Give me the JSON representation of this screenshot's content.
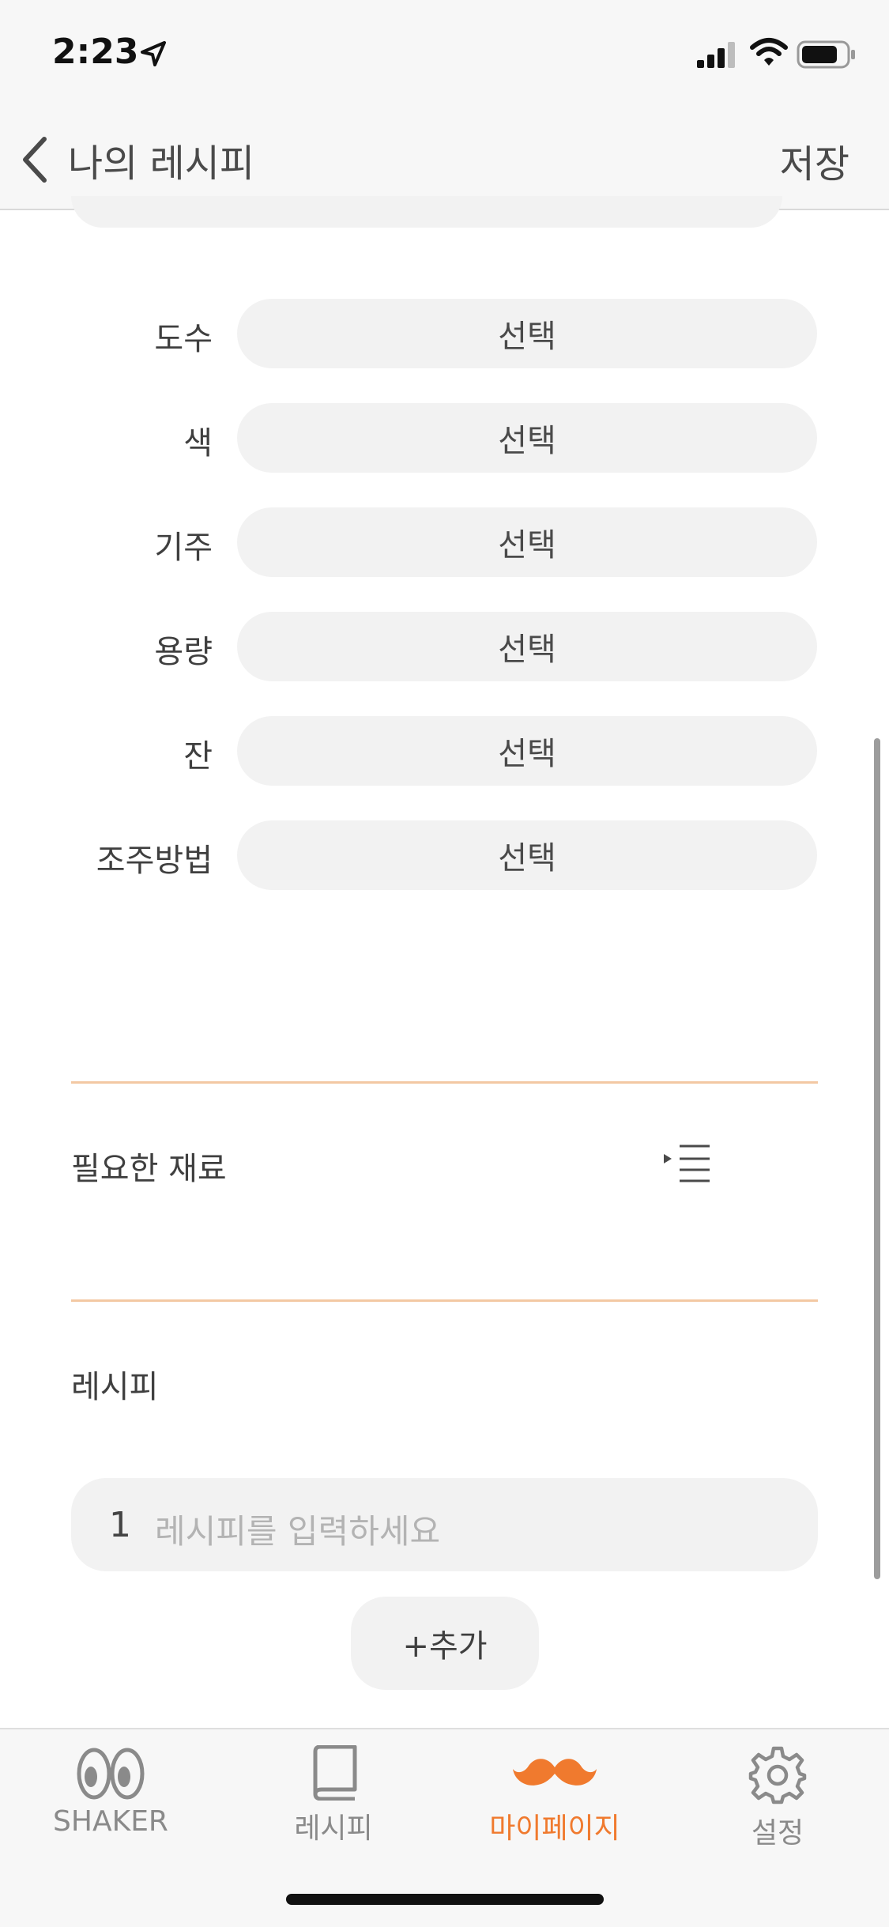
{
  "status_bar": {
    "time": "2:23"
  },
  "nav": {
    "title": "나의 레시피",
    "save_label": "저장"
  },
  "form": {
    "rows": [
      {
        "label": "도수",
        "value": "선택"
      },
      {
        "label": "색",
        "value": "선택"
      },
      {
        "label": "기주",
        "value": "선택"
      },
      {
        "label": "용량",
        "value": "선택"
      },
      {
        "label": "잔",
        "value": "선택"
      },
      {
        "label": "조주방법",
        "value": "선택"
      }
    ]
  },
  "ingredients": {
    "label": "필요한 재료"
  },
  "recipe": {
    "label": "레시피",
    "step_number": "1",
    "placeholder": "레시피를 입력하세요",
    "add_label": "+추가"
  },
  "tabs": [
    {
      "label": "SHAKER",
      "icon": "eyes-icon"
    },
    {
      "label": "레시피",
      "icon": "book-icon"
    },
    {
      "label": "마이페이지",
      "icon": "mustache-icon",
      "active": true
    },
    {
      "label": "설정",
      "icon": "gear-icon"
    }
  ],
  "colors": {
    "accent": "#f07a2e",
    "field_bg": "#f2f2f2",
    "divider": "#f3c8a3"
  }
}
